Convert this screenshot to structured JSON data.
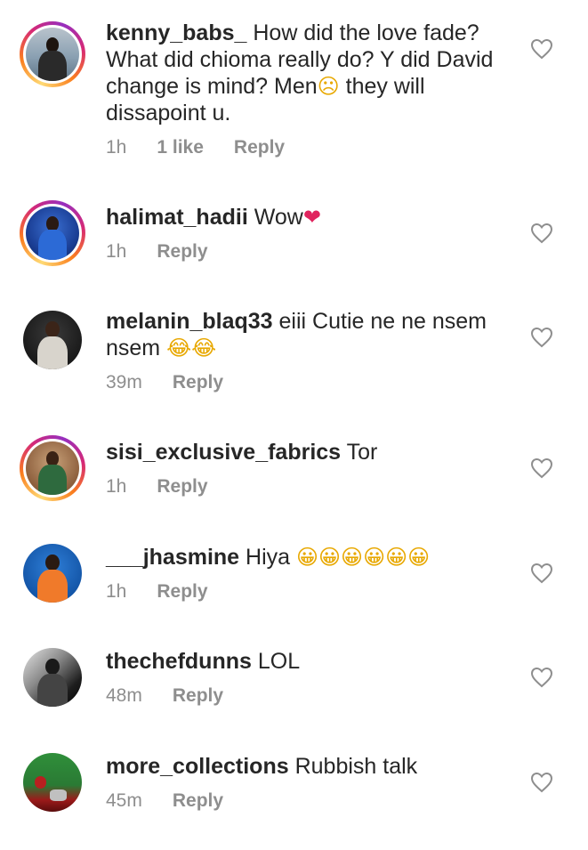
{
  "comments": [
    {
      "username": "kenny_babs_",
      "text": "How did the love fade? What did chioma really do? Y did David change is mind? Men",
      "emoji": "☹",
      "text_after": " they will dissapoint u.",
      "time": "1h",
      "likes": "1 like",
      "reply": "Reply"
    },
    {
      "username": "halimat_hadii",
      "text": "Wow",
      "emoji": "❤",
      "text_after": "",
      "time": "1h",
      "likes": "",
      "reply": "Reply"
    },
    {
      "username": "melanin_blaq33",
      "text": "eiii Cutie ne ne nsem nsem ",
      "emoji": "😂😂",
      "text_after": "",
      "time": "39m",
      "likes": "",
      "reply": "Reply"
    },
    {
      "username": "sisi_exclusive_fabrics",
      "text": "Tor",
      "emoji": "",
      "text_after": "",
      "time": "1h",
      "likes": "",
      "reply": "Reply"
    },
    {
      "username": "___jhasmine",
      "text": "Hiya ",
      "emoji": "😀😀😀😀😀😀",
      "text_after": "",
      "time": "1h",
      "likes": "",
      "reply": "Reply"
    },
    {
      "username": "thechefdunns",
      "text": "LOL",
      "emoji": "",
      "text_after": "",
      "time": "48m",
      "likes": "",
      "reply": "Reply"
    },
    {
      "username": "more_collections",
      "text": "Rubbish talk",
      "emoji": "",
      "text_after": "",
      "time": "45m",
      "likes": "",
      "reply": "Reply"
    }
  ],
  "icons": {
    "like": "heart-outline-icon"
  },
  "colors": {
    "text": "#262626",
    "meta": "#8e8e8e",
    "story_ring_start": "#feda75",
    "story_ring_end": "#d62976"
  }
}
